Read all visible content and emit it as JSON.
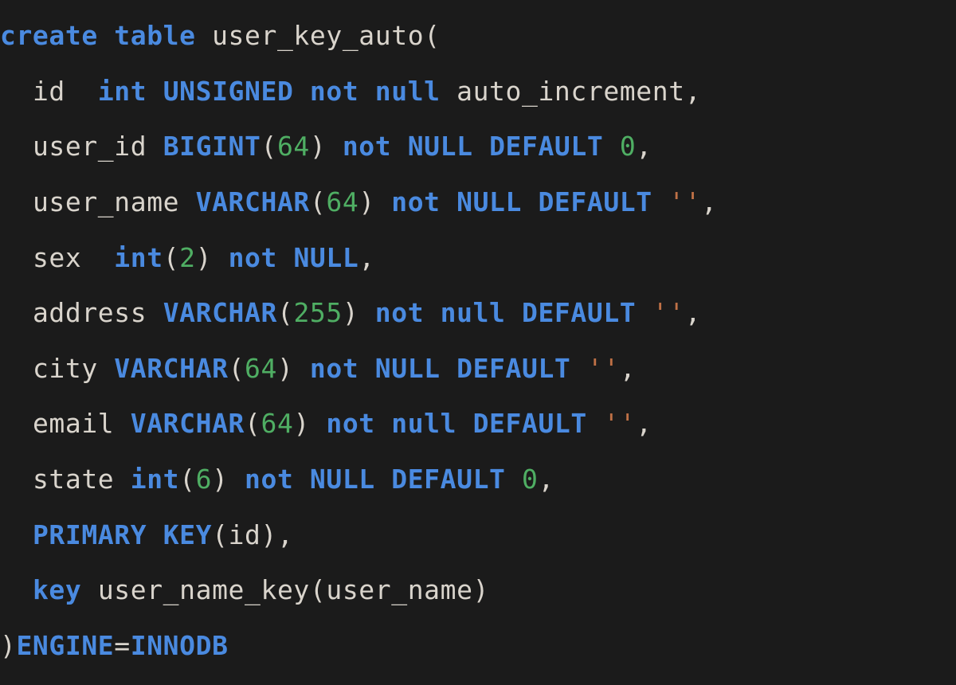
{
  "sql": {
    "tokens": [
      [
        [
          "kw",
          "create"
        ],
        [
          "sp",
          " "
        ],
        [
          "kw",
          "table"
        ],
        [
          "sp",
          " "
        ],
        [
          "id",
          "user_key_auto"
        ],
        [
          "pn",
          "("
        ]
      ],
      [
        [
          "indent",
          "  "
        ],
        [
          "id",
          "id"
        ],
        [
          "sp",
          "  "
        ],
        [
          "kw",
          "int"
        ],
        [
          "sp",
          " "
        ],
        [
          "kw",
          "UNSIGNED"
        ],
        [
          "sp",
          " "
        ],
        [
          "kw",
          "not"
        ],
        [
          "sp",
          " "
        ],
        [
          "kw",
          "null"
        ],
        [
          "sp",
          " "
        ],
        [
          "id",
          "auto_increment"
        ],
        [
          "pn",
          ","
        ]
      ],
      [
        [
          "indent",
          "  "
        ],
        [
          "id",
          "user_id"
        ],
        [
          "sp",
          " "
        ],
        [
          "kw",
          "BIGINT"
        ],
        [
          "pn",
          "("
        ],
        [
          "num",
          "64"
        ],
        [
          "pn",
          ")"
        ],
        [
          "sp",
          " "
        ],
        [
          "kw",
          "not"
        ],
        [
          "sp",
          " "
        ],
        [
          "kw",
          "NULL"
        ],
        [
          "sp",
          " "
        ],
        [
          "kw",
          "DEFAULT"
        ],
        [
          "sp",
          " "
        ],
        [
          "num",
          "0"
        ],
        [
          "pn",
          ","
        ]
      ],
      [
        [
          "indent",
          "  "
        ],
        [
          "id",
          "user_name"
        ],
        [
          "sp",
          " "
        ],
        [
          "kw",
          "VARCHAR"
        ],
        [
          "pn",
          "("
        ],
        [
          "num",
          "64"
        ],
        [
          "pn",
          ")"
        ],
        [
          "sp",
          " "
        ],
        [
          "kw",
          "not"
        ],
        [
          "sp",
          " "
        ],
        [
          "kw",
          "NULL"
        ],
        [
          "sp",
          " "
        ],
        [
          "kw",
          "DEFAULT"
        ],
        [
          "sp",
          " "
        ],
        [
          "str",
          "''"
        ],
        [
          "pn",
          ","
        ]
      ],
      [
        [
          "indent",
          "  "
        ],
        [
          "id",
          "sex"
        ],
        [
          "sp",
          "  "
        ],
        [
          "kw",
          "int"
        ],
        [
          "pn",
          "("
        ],
        [
          "num",
          "2"
        ],
        [
          "pn",
          ")"
        ],
        [
          "sp",
          " "
        ],
        [
          "kw",
          "not"
        ],
        [
          "sp",
          " "
        ],
        [
          "kw",
          "NULL"
        ],
        [
          "pn",
          ","
        ]
      ],
      [
        [
          "indent",
          "  "
        ],
        [
          "id",
          "address"
        ],
        [
          "sp",
          " "
        ],
        [
          "kw",
          "VARCHAR"
        ],
        [
          "pn",
          "("
        ],
        [
          "num",
          "255"
        ],
        [
          "pn",
          ")"
        ],
        [
          "sp",
          " "
        ],
        [
          "kw",
          "not"
        ],
        [
          "sp",
          " "
        ],
        [
          "kw",
          "null"
        ],
        [
          "sp",
          " "
        ],
        [
          "kw",
          "DEFAULT"
        ],
        [
          "sp",
          " "
        ],
        [
          "str",
          "''"
        ],
        [
          "pn",
          ","
        ]
      ],
      [
        [
          "indent",
          "  "
        ],
        [
          "id",
          "city"
        ],
        [
          "sp",
          " "
        ],
        [
          "kw",
          "VARCHAR"
        ],
        [
          "pn",
          "("
        ],
        [
          "num",
          "64"
        ],
        [
          "pn",
          ")"
        ],
        [
          "sp",
          " "
        ],
        [
          "kw",
          "not"
        ],
        [
          "sp",
          " "
        ],
        [
          "kw",
          "NULL"
        ],
        [
          "sp",
          " "
        ],
        [
          "kw",
          "DEFAULT"
        ],
        [
          "sp",
          " "
        ],
        [
          "str",
          "''"
        ],
        [
          "pn",
          ","
        ]
      ],
      [
        [
          "indent",
          "  "
        ],
        [
          "id",
          "email"
        ],
        [
          "sp",
          " "
        ],
        [
          "kw",
          "VARCHAR"
        ],
        [
          "pn",
          "("
        ],
        [
          "num",
          "64"
        ],
        [
          "pn",
          ")"
        ],
        [
          "sp",
          " "
        ],
        [
          "kw",
          "not"
        ],
        [
          "sp",
          " "
        ],
        [
          "kw",
          "null"
        ],
        [
          "sp",
          " "
        ],
        [
          "kw",
          "DEFAULT"
        ],
        [
          "sp",
          " "
        ],
        [
          "str",
          "''"
        ],
        [
          "pn",
          ","
        ]
      ],
      [
        [
          "indent",
          "  "
        ],
        [
          "id",
          "state"
        ],
        [
          "sp",
          " "
        ],
        [
          "kw",
          "int"
        ],
        [
          "pn",
          "("
        ],
        [
          "num",
          "6"
        ],
        [
          "pn",
          ")"
        ],
        [
          "sp",
          " "
        ],
        [
          "kw",
          "not"
        ],
        [
          "sp",
          " "
        ],
        [
          "kw",
          "NULL"
        ],
        [
          "sp",
          " "
        ],
        [
          "kw",
          "DEFAULT"
        ],
        [
          "sp",
          " "
        ],
        [
          "num",
          "0"
        ],
        [
          "pn",
          ","
        ]
      ],
      [
        [
          "indent",
          "  "
        ],
        [
          "kw",
          "PRIMARY"
        ],
        [
          "sp",
          " "
        ],
        [
          "kw",
          "KEY"
        ],
        [
          "pn",
          "("
        ],
        [
          "id",
          "id"
        ],
        [
          "pn",
          ")"
        ],
        [
          "pn",
          ","
        ]
      ],
      [
        [
          "indent",
          "  "
        ],
        [
          "kw",
          "key"
        ],
        [
          "sp",
          " "
        ],
        [
          "id",
          "user_name_key"
        ],
        [
          "pn",
          "("
        ],
        [
          "id",
          "user_name"
        ],
        [
          "pn",
          ")"
        ]
      ],
      [
        [
          "pn",
          ")"
        ],
        [
          "kw",
          "ENGINE"
        ],
        [
          "pn",
          "="
        ],
        [
          "kw",
          "INNODB"
        ]
      ]
    ]
  }
}
